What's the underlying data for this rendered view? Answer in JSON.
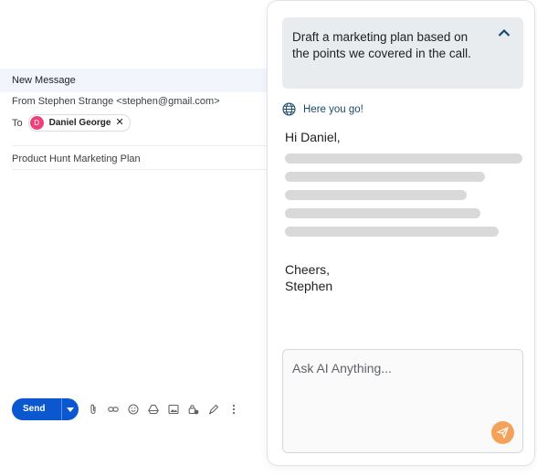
{
  "compose": {
    "header_title": "New Message",
    "from_line": "From Stephen Strange <stephen@gmail.com>",
    "to_label": "To",
    "recipient": {
      "initial": "D",
      "name": "Daniel George",
      "remove_glyph": "✕"
    },
    "subject": "Product Hunt Marketing Plan",
    "send_label": "Send",
    "toolbar_icons": [
      "attach-icon",
      "link-icon",
      "emoji-icon",
      "drive-icon",
      "photo-icon",
      "lock-clock-icon",
      "pen-icon",
      "more-vert-icon"
    ],
    "colors": {
      "header_bg": "#f2f6fc",
      "send_bg": "#0b57d0",
      "avatar_bg": "#ec407a"
    }
  },
  "ai_panel": {
    "prompt": "Draft a marketing plan based on the points we covered in the call.",
    "reply_label": "Here you go!",
    "greeting": "Hi Daniel,",
    "signoff_line1": "Cheers,",
    "signoff_line2": "Stephen",
    "placeholder_lines": 5,
    "input_placeholder": "Ask AI Anything...",
    "colors": {
      "prompt_bg": "#e8ecee",
      "send_btn": "#f4a259",
      "placeholder_bar": "#d9d9d9"
    }
  }
}
